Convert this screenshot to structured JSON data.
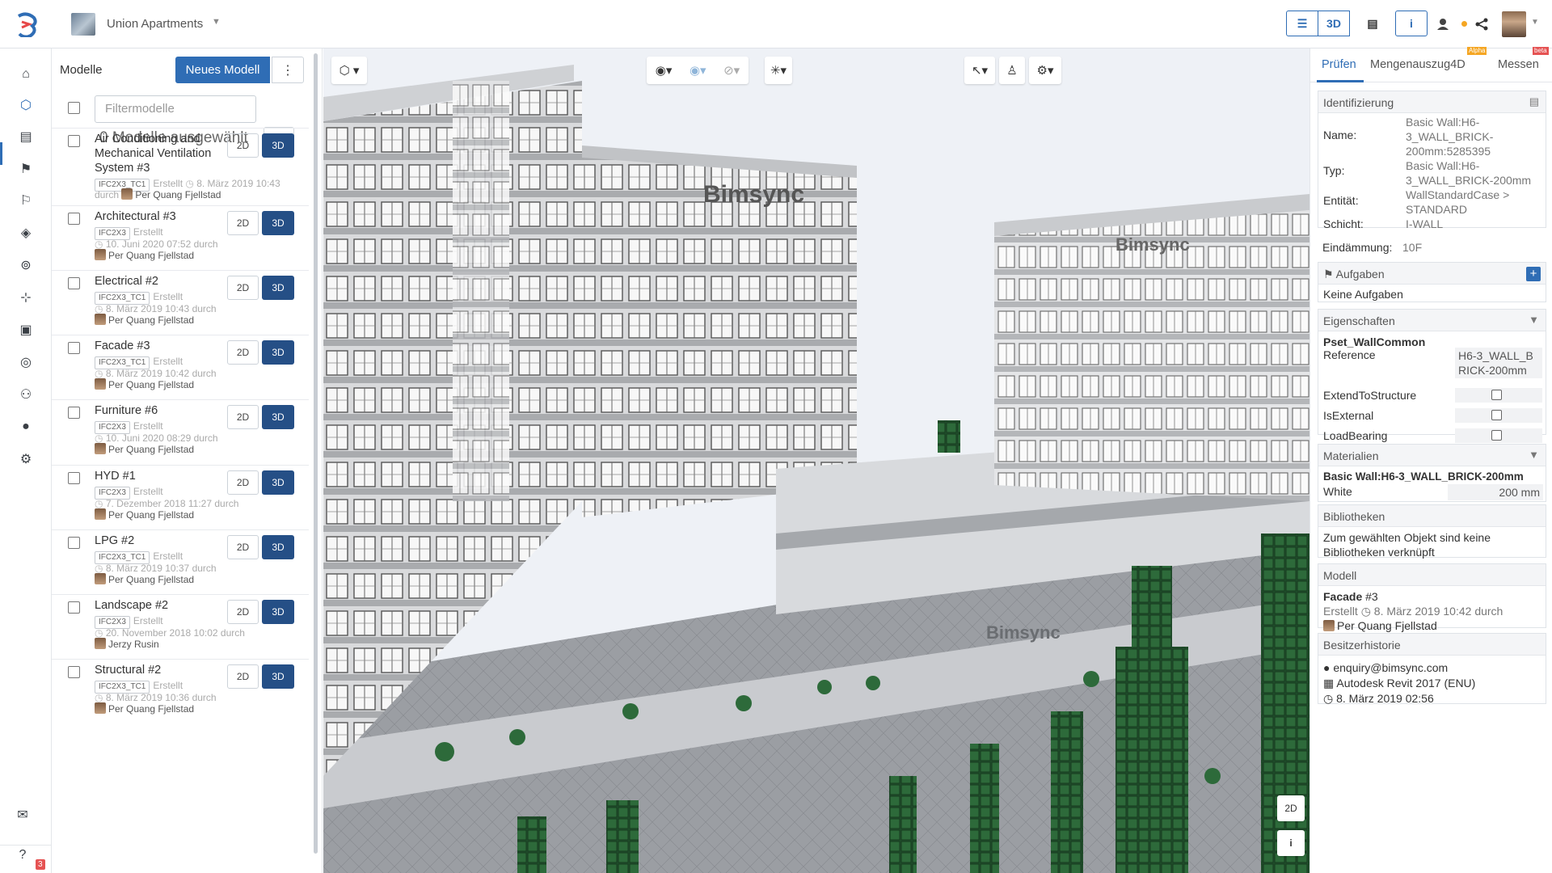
{
  "project": {
    "name": "Union Apartments"
  },
  "topbar": {
    "view_buttons": [
      "☰",
      "3D",
      "▤",
      "i"
    ],
    "accent": "#2f6db5"
  },
  "models_panel": {
    "title": "Modelle",
    "new_model_label": "Neues Modell",
    "filter_placeholder": "Filtermodelle",
    "selected_text": "0 Modelle ausgewählt",
    "selected_3d_label": "3D",
    "btn_2d": "2D",
    "btn_3d": "3D",
    "items": [
      {
        "name": "Air Conditioning and Mechanical Ventilation System #3",
        "tag": "IFC2X3_TC1",
        "created": "Erstellt",
        "date": "8. März 2019 10:43",
        "by_prefix": "durch",
        "user": "Per Quang Fjellstad"
      },
      {
        "name": "Architectural #3",
        "tag": "IFC2X3",
        "created": "Erstellt",
        "date": "10. Juni 2020 07:52 durch",
        "user": "Per Quang Fjellstad"
      },
      {
        "name": "Electrical #2",
        "tag": "IFC2X3_TC1",
        "created": "Erstellt",
        "date": "8. März 2019 10:43 durch",
        "user": "Per Quang Fjellstad"
      },
      {
        "name": "Facade #3",
        "tag": "IFC2X3_TC1",
        "created": "Erstellt",
        "date": "8. März 2019 10:42 durch",
        "user": "Per Quang Fjellstad"
      },
      {
        "name": "Furniture #6",
        "tag": "IFC2X3",
        "created": "Erstellt",
        "date": "10. Juni 2020 08:29 durch",
        "user": "Per Quang Fjellstad"
      },
      {
        "name": "HYD #1",
        "tag": "IFC2X3",
        "created": "Erstellt",
        "date": "7. Dezember 2018 11:27 durch",
        "user": "Per Quang Fjellstad"
      },
      {
        "name": "LPG #2",
        "tag": "IFC2X3_TC1",
        "created": "Erstellt",
        "date": "8. März 2019 10:37 durch",
        "user": "Per Quang Fjellstad"
      },
      {
        "name": "Landscape #2",
        "tag": "IFC2X3",
        "created": "Erstellt",
        "date": "20. November 2018 10:02 durch",
        "user": "Jerzy Rusin"
      },
      {
        "name": "Structural #2",
        "tag": "IFC2X3_TC1",
        "created": "Erstellt",
        "date": "8. März 2019 10:36 durch",
        "user": "Per Quang Fjellstad"
      }
    ]
  },
  "viewer": {
    "brand_sign": "Bimsync",
    "btn_2d": "2D",
    "btn_info": "i"
  },
  "right_panel": {
    "tabs": [
      {
        "label": "Prüfen"
      },
      {
        "label": "Mengenauszug4D",
        "badge": "Alpha"
      },
      {
        "label": "Messen",
        "badge": "beta"
      }
    ],
    "identification": {
      "title": "Identifizierung",
      "rows": [
        {
          "k": "Name:",
          "v": "Basic Wall:H6-3_WALL_BRICK-200mm:5285395"
        },
        {
          "k": "Typ:",
          "v": "Basic Wall:H6-3_WALL_BRICK-200mm"
        },
        {
          "k": "Entität:",
          "v": "WallStandardCase > STANDARD"
        },
        {
          "k": "Schicht:",
          "v": "I-WALL"
        },
        {
          "k": "Eindämmung:",
          "v": "10F"
        }
      ]
    },
    "tasks": {
      "title": "Aufgaben",
      "empty": "Keine Aufgaben"
    },
    "properties": {
      "title": "Eigenschaften",
      "pset": "Pset_WallCommon",
      "reference_label": "Reference",
      "reference_value": "H6-3_WALL_BRICK-200mm",
      "flags": [
        "ExtendToStructure",
        "IsExternal",
        "LoadBearing"
      ]
    },
    "materials": {
      "title": "Materialien",
      "name": "Basic Wall:H6-3_WALL_BRICK-200mm",
      "material": "White",
      "thickness": "200 mm"
    },
    "libraries": {
      "title": "Bibliotheken",
      "text": "Zum gewählten Objekt sind keine Bibliotheken verknüpft"
    },
    "model": {
      "title": "Modell",
      "name": "Facade",
      "version": "#3",
      "created": "Erstellt",
      "date": "8. März 2019 10:42 durch",
      "user": "Per Quang Fjellstad"
    },
    "owner_history": {
      "title": "Besitzerhistorie",
      "email": "enquiry@bimsync.com",
      "app": "Autodesk Revit 2017 (ENU)",
      "date": "8. März 2019 02:56"
    }
  },
  "leftnav": {
    "mail_count": "3"
  }
}
